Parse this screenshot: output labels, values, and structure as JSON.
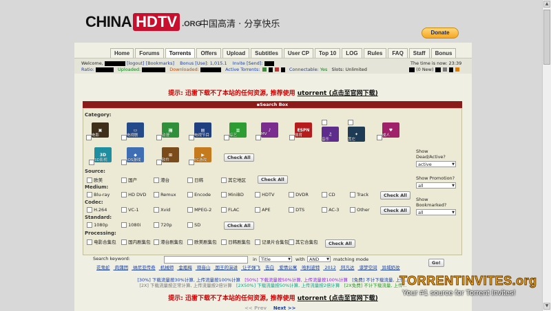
{
  "header": {
    "logo_china": "CHINA",
    "logo_hdtv": "HDTV",
    "logo_org": ".ORG",
    "slogan": "中国高清 · 分享快乐",
    "donate_label": "Donate"
  },
  "nav": {
    "tabs": [
      "Home",
      "Forums",
      "Torrents",
      "Offers",
      "Upload",
      "Subtitles",
      "User CP",
      "Top 10",
      "LOG",
      "Rules",
      "FAQ",
      "Staff",
      "Bonus"
    ],
    "active": "Torrents"
  },
  "userbar": {
    "welcome": "Welcome,",
    "logout": "[logout]",
    "bookmarks": "[Bookmarks]",
    "bonus_label": "Bonus [Use]: 1,015.1",
    "invite_label": "Invite [Send]:",
    "time_label": "The time is now: 23:39",
    "ratio_label": "Ratio:",
    "uploaded_label": "Uploaded:",
    "downloaded_label": "Downloaded:",
    "active_torrents_label": "Active Torrents:",
    "connectable_label": "Connectable:",
    "connectable_value": "Yes",
    "slots_label": "Slots: Unlimited",
    "messages_label": "(0 New)"
  },
  "notice": {
    "text": "提示: 迅雷下载不了本站的任何资源, 推荐使用",
    "link": "utorrent (点击至官网下载)"
  },
  "search_box": {
    "title": "Search Box",
    "category_label": "Category:",
    "categories": [
      {
        "name": "电影",
        "color": "#3f2f1a"
      },
      {
        "name": "电视剧",
        "color": "#244a8a"
      },
      {
        "name": "动漫",
        "color": "#2f8f3a"
      },
      {
        "name": "电视节目",
        "color": "#1f3f80"
      },
      {
        "name": "综艺",
        "color": "#2c9c33"
      },
      {
        "name": "MV",
        "color": "#7a2d8f"
      },
      {
        "name": "体育",
        "color": "#b71c1c"
      },
      {
        "name": "音乐",
        "color": "#5e2d8c"
      },
      {
        "name": "其它",
        "color": "#1d3b55"
      },
      {
        "name": "成人",
        "color": "#a0206a"
      },
      {
        "name": "3D影视",
        "color": "#1f8ea0"
      },
      {
        "name": "iOS游戏",
        "color": "#3f6eb4"
      },
      {
        "name": "软件",
        "color": "#7a4b1b"
      },
      {
        "name": "PC游戏",
        "color": "#c57b1d"
      }
    ],
    "check_all": "Check All",
    "source_label": "Source:",
    "sources": [
      "欧美",
      "国产",
      "港台",
      "日韩",
      "其它地区"
    ],
    "medium_label": "Medium:",
    "mediums": [
      "Blu-ray",
      "HD DVD",
      "Remux",
      "Encode",
      "MiniBD",
      "HDTV",
      "DVDR",
      "CD",
      "Track"
    ],
    "codec_label": "Codec:",
    "codecs": [
      "H.264",
      "VC-1",
      "Xvid",
      "MPEG-2",
      "FLAC",
      "APE",
      "DTS",
      "AC-3",
      "Other"
    ],
    "standard_label": "Standard:",
    "standards": [
      "1080p",
      "1080i",
      "720p",
      "SD"
    ],
    "processing_label": "Processing:",
    "processings": [
      "电影合集包",
      "国内剧集包",
      "港台剧集包",
      "欧美剧集包",
      "日韩剧集包",
      "记录片合集包",
      "其它合集包"
    ],
    "show_dead_label": "Show Dead/Active?",
    "show_dead_value": "active",
    "show_promotion_label": "Show Promotion?",
    "show_promotion_value": "all",
    "show_bookmarked_label": "Show Bookmarked?",
    "show_bookmarked_value": "all"
  },
  "search_row": {
    "keyword_label": "Search keyword:",
    "in_label": "in",
    "in_value": "Title",
    "with_label": "with",
    "with_value": "AND",
    "matching_label": "matching mode",
    "go_label": "Go!",
    "hot_words": [
      "花鬼蛇",
      "肉蒲团",
      "纳尼亚传奇",
      "机械师",
      "金瓶梅",
      "观音山",
      "国王的演讲",
      "让子弹飞",
      "告白",
      "爱情公寓",
      "哈利波特",
      "2012",
      "阿凡达",
      "谍梦空间",
      "异域奶妆"
    ]
  },
  "promo": {
    "line1": [
      "[30%] 下载流量按30%计算, 上传流量按100%计算",
      "[50%] 下载流量按50%计算, 上传流量按100%计算",
      "[免费] 不计下载流量, 上传..."
    ],
    "line2": [
      "[2X] 下载流量按正常计算, 上传流量按2倍计算",
      "[2X50%] 下载流量按50%计算, 上传流量按2倍计算",
      "[2X免费] 不计下载流量, 上传..."
    ]
  },
  "pager": {
    "prev": "<< Prev",
    "next": "Next >>"
  },
  "watermark": {
    "site": "TORRENTINVITES.org",
    "tagline": "Your #1 source for Torrent Invites!"
  }
}
